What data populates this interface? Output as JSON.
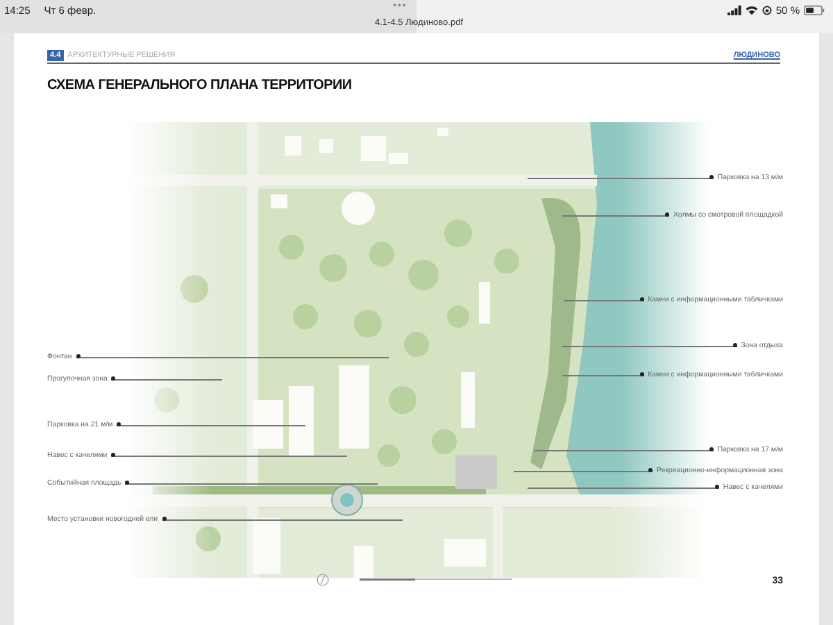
{
  "status_bar": {
    "time": "14:25",
    "date": "Чт 6 февр.",
    "battery": "50 %"
  },
  "toolbar": {
    "more": "•••",
    "file_name": "4.1-4.5 Людиново.pdf"
  },
  "page": {
    "section_number": "4.4",
    "section_title": "АРХИТЕКТУРНЫЕ РЕШЕНИЯ",
    "town": "ЛЮДИНОВО",
    "title": "СХЕМА ГЕНЕРАЛЬНОГО ПЛАНА ТЕРРИТОРИИ",
    "callouts_left": [
      "Фонтан",
      "Прогулочная зона",
      "Парковка на 21 м/м",
      "Навес с качелями",
      "Событийная площадь",
      "Место установки новогодней ели"
    ],
    "callouts_right": [
      "Парковка на 13 м/м",
      "Холмы со смотровой площадкой",
      "Камни с информационными табличками",
      "Зона отдыха",
      "Камни с информационными табличками",
      "Парковка на 17 м/м",
      "Рекреационно-информационная зона",
      "Навес с качелями"
    ],
    "page_number": "33"
  }
}
